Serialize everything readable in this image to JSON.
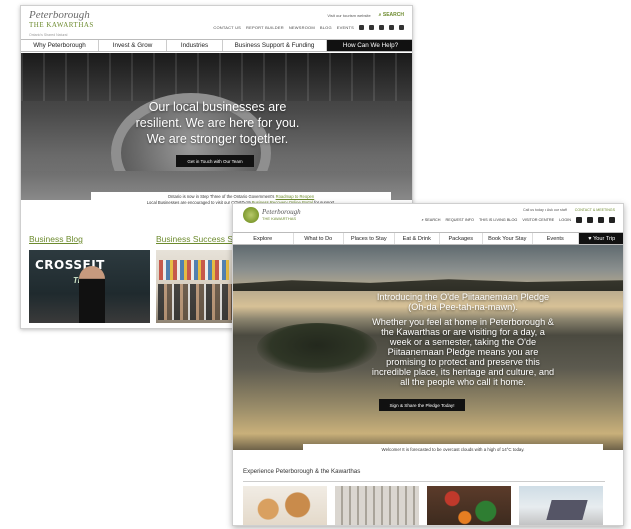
{
  "win1": {
    "logo": {
      "line1": "Peterborough",
      "line2": "THE KAWARTHAS",
      "tagline": "Ontario's Shared Natural"
    },
    "util": {
      "visit_text": "Visit our tourism website",
      "search_label": "SEARCH"
    },
    "top_links": [
      "CONTACT US",
      "REPORT BUILDER",
      "NEWSROOM",
      "BLOG",
      "EVENTS"
    ],
    "nav": [
      "Why Peterborough",
      "Invest & Grow",
      "Industries",
      "Business Support & Funding",
      "How Can We Help?"
    ],
    "hero": {
      "line1": "Our local businesses are",
      "line2": "resilient. We are here for you.",
      "line3": "We are stronger together.",
      "button": "Get in Touch with Our Team"
    },
    "notice": {
      "line1_pre": "Ontario is now in Step Three of the Ontario Government's ",
      "line1_link": "Roadmap to Reopen",
      "line2_pre": "Local Businesses are encouraged to visit our COVID-19 ",
      "line2_link": "Business Recovery Online Portal",
      "line2_post": " for support."
    },
    "sections": {
      "blog": "Business Blog",
      "stories": "Business Success Sto"
    },
    "blog_image_text": {
      "word": "CROSSFIT",
      "word2": "Tribe"
    }
  },
  "win2": {
    "logo": {
      "line1": "Peterborough",
      "line2": "THE KAWARTHAS"
    },
    "util": {
      "phone": "Call us today • Ask our staff",
      "contact": "CONTACT & MEETINGS"
    },
    "links": [
      "SEARCH",
      "REQUEST INFO",
      "THIS IS LIVING BLOG",
      "VISITOR CENTRE",
      "LOGIN"
    ],
    "nav": [
      "Explore",
      "What to Do",
      "Places to Stay",
      "Eat & Drink",
      "Packages",
      "Book Your Stay",
      "Events",
      "Your Trip"
    ],
    "hero": {
      "title1": "Introducing the O'de Piitaanemaan Pledge",
      "title2": "(Oh-da Pee-tah-na-mawn).",
      "body1": "Whether you feel at home in Peterborough &",
      "body2": "the Kawarthas or are visiting for a day, a",
      "body3": "week or a semester, taking the O'de",
      "body4": "Piitaanemaan Pledge means you are",
      "body5": "promising to protect and preserve this",
      "body6": "incredible place, its heritage and culture, and",
      "body7": "all the people who call it home.",
      "button": "Sign & Share the Pledge Today!"
    },
    "weather": "Welcome! It is forecasted to be overcast clouds with a high of 14°C today.",
    "experience_title": "Experience Peterborough & the Kawarthas"
  },
  "colors": {
    "accent_green": "#6d8b2e",
    "nav_dark": "#111111"
  }
}
